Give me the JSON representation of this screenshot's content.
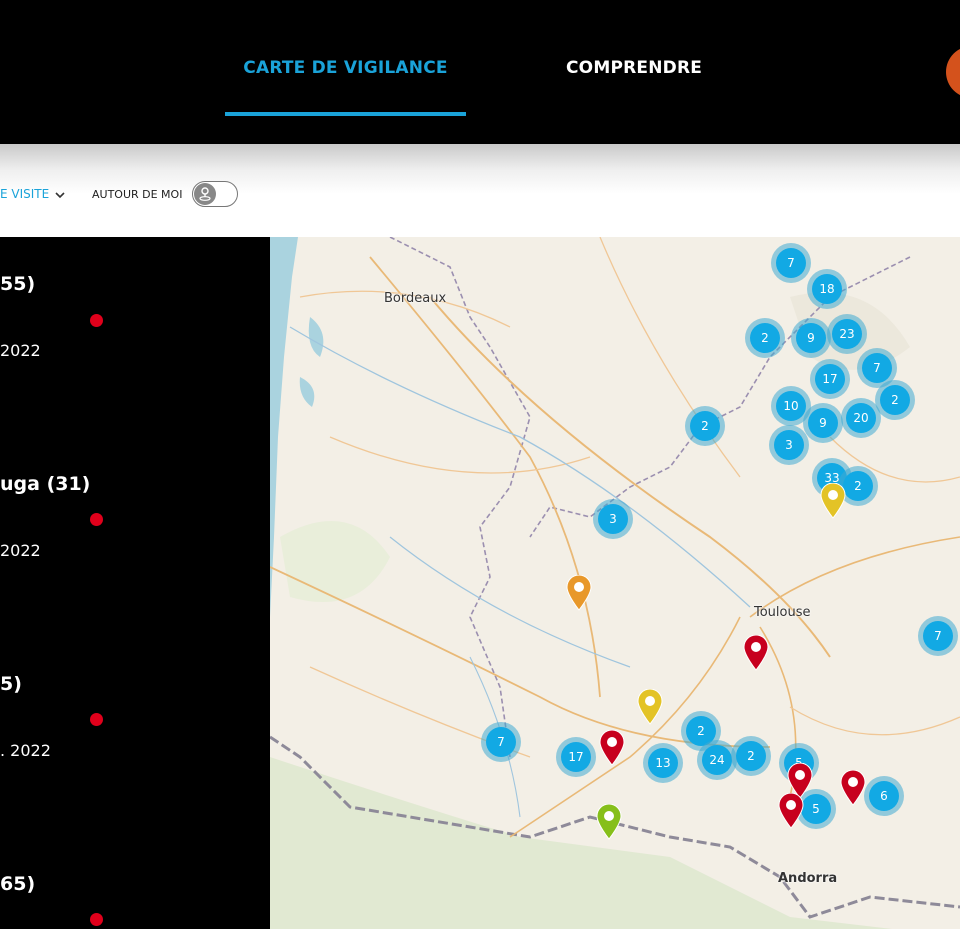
{
  "nav": {
    "tab_active": "CARTE DE VIGILANCE",
    "tab_2": "COMPRENDRE"
  },
  "filters": {
    "visit_label": "E VISITE",
    "around_me_label": "AUTOUR DE MOI",
    "around_me_enabled": false
  },
  "list": [
    {
      "title": "55)",
      "date": "2022",
      "status_color": "#e0001b"
    },
    {
      "title": "uga (31)",
      "date": "2022",
      "status_color": "#e0001b"
    },
    {
      "title": "5)",
      "date": ". 2022",
      "status_color": "#e0001b"
    },
    {
      "title": "65)",
      "status_color": "#e0001b"
    }
  ],
  "map": {
    "cities": [
      "Bordeaux",
      "Toulouse",
      "Andorra"
    ],
    "clusters": [
      7,
      18,
      2,
      9,
      23,
      17,
      7,
      2,
      10,
      9,
      20,
      3,
      2,
      33,
      2,
      3,
      7,
      7,
      17,
      13,
      2,
      24,
      2,
      5,
      5,
      6
    ],
    "pins": [
      {
        "color": "#e3c326"
      },
      {
        "color": "#e8982a"
      },
      {
        "color": "#c7001e"
      },
      {
        "color": "#e3c326"
      },
      {
        "color": "#c7001e"
      },
      {
        "color": "#c7001e"
      },
      {
        "color": "#c7001e"
      },
      {
        "color": "#c7001e"
      },
      {
        "color": "#86bf1a"
      }
    ]
  },
  "colors": {
    "accent": "#1aa3d9",
    "cluster": "#12a9e4",
    "alert_dot": "#e0001b",
    "cta_orange": "#d4521c"
  }
}
